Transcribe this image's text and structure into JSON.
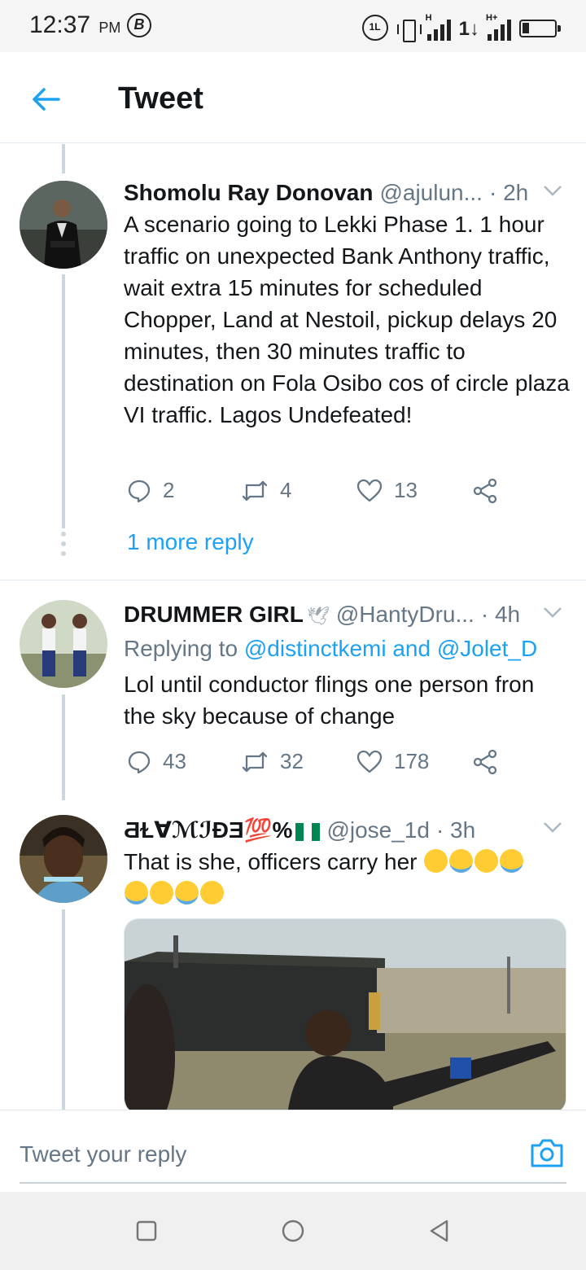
{
  "status_bar": {
    "time": "12:37",
    "ampm": "PM",
    "b_icon": "B",
    "net_label_1": "H",
    "net_label_2": "H+",
    "icons": [
      "b-circle-icon",
      "dual-sim-icon",
      "vibrate-icon",
      "signal-icon",
      "data-arrows-icon",
      "battery-icon"
    ]
  },
  "header": {
    "back_icon": "back-arrow-icon",
    "title": "Tweet"
  },
  "tweets": [
    {
      "name": "Shomolu Ray Donovan",
      "handle": "@ajulun...",
      "time": "· 2h",
      "text": "A scenario going to Lekki Phase 1. 1 hour traffic on unexpected Bank Anthony traffic, wait extra 15 minutes for scheduled Chopper, Land at Nestoil, pickup delays 20 minutes, then 30 minutes traffic to destination on Fola Osibo cos of circle plaza VI traffic. Lagos Undefeated!",
      "replies": "2",
      "retweets": "4",
      "likes": "13",
      "more_replies": "1 more reply"
    },
    {
      "name": "DRUMMER GIRL",
      "handle": "@HantyDru...",
      "time": "· 4h",
      "replying_prefix": "Replying to",
      "replying_users": "@distinctkemi and @Jolet_D",
      "text": "Lol until conductor flings one person fron the sky because of change",
      "replies": "43",
      "retweets": "32",
      "likes": "178"
    },
    {
      "name": "ƋⱢ∀ℳℐƉƎ💯%",
      "handle": "@jose_1d",
      "time": "· 3h",
      "text": "That is she, officers carry her",
      "emojis": [
        "😁",
        "😂",
        "😀",
        "😂",
        "😂",
        "😀",
        "😂",
        "😁"
      ]
    }
  ],
  "reply_bar": {
    "placeholder": "Tweet your reply",
    "camera_icon": "camera-icon"
  },
  "nav_bar": {
    "icons": [
      "recents-square-icon",
      "home-circle-icon",
      "back-triangle-icon"
    ]
  },
  "colors": {
    "accent": "#1da1f2",
    "secondary_text": "#657786",
    "divider": "#e1e8ed"
  }
}
